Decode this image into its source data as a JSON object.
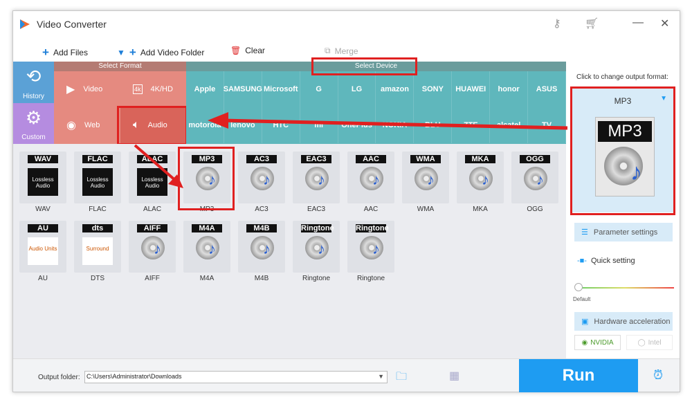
{
  "app": {
    "title": "Video Converter"
  },
  "toolbar": {
    "add_files": "Add Files",
    "add_folder": "Add Video Folder",
    "clear": "Clear",
    "merge": "Merge"
  },
  "sidebar": {
    "history": "History",
    "custom": "Custom"
  },
  "format": {
    "header": "Select Format",
    "items": [
      "Video",
      "4K/HD",
      "Web",
      "Audio"
    ],
    "selected": "Audio"
  },
  "device": {
    "header": "Select Device",
    "brands_row1": [
      "Apple",
      "SAMSUNG",
      "Microsoft",
      "G",
      "LG",
      "amazon",
      "SONY",
      "HUAWEI",
      "honor",
      "ASUS"
    ],
    "brands_row2": [
      "motorola",
      "lenovo",
      "HTC",
      "mi",
      "OnePlus",
      "NOKIA",
      "BLU",
      "ZTE",
      "alcatel",
      "TV"
    ]
  },
  "formats": [
    {
      "label": "WAV",
      "sub": "Lossless Audio",
      "name": "WAV"
    },
    {
      "label": "FLAC",
      "sub": "Lossless Audio",
      "name": "FLAC"
    },
    {
      "label": "ALAC",
      "sub": "Lossless Audio",
      "name": "ALAC"
    },
    {
      "label": "MP3",
      "name": "MP3",
      "selected": true
    },
    {
      "label": "AC3",
      "name": "AC3"
    },
    {
      "label": "EAC3",
      "name": "EAC3"
    },
    {
      "label": "AAC",
      "name": "AAC"
    },
    {
      "label": "WMA",
      "name": "WMA"
    },
    {
      "label": "MKA",
      "name": "MKA"
    },
    {
      "label": "OGG",
      "name": "OGG"
    },
    {
      "label": "AU",
      "sub": "Audio Units",
      "name": "AU"
    },
    {
      "label": "dts",
      "sub": "Surround",
      "name": "DTS"
    },
    {
      "label": "AIFF",
      "name": "AIFF"
    },
    {
      "label": "M4A",
      "name": "M4A"
    },
    {
      "label": "M4B",
      "name": "M4B"
    },
    {
      "label": "Ringtone",
      "name": "Ringtone"
    },
    {
      "label": "Ringtone",
      "name": "Ringtone"
    }
  ],
  "right": {
    "hint": "Click to change output format:",
    "output_format": "MP3",
    "icon_label": "MP3",
    "parameter_settings": "Parameter settings",
    "quick_setting": "Quick setting",
    "slider_label": "Default",
    "quality_level": 0,
    "hw_accel": "Hardware acceleration",
    "nvidia": "NVIDIA",
    "intel": "Intel"
  },
  "bottom": {
    "output_label": "Output folder:",
    "output_path": "C:\\Users\\Administrator\\Downloads",
    "run": "Run"
  },
  "colors": {
    "accent": "#1e9cf2",
    "format_bg": "#e58a80",
    "device_bg": "#5fb7bc",
    "highlight": "#e02020"
  }
}
